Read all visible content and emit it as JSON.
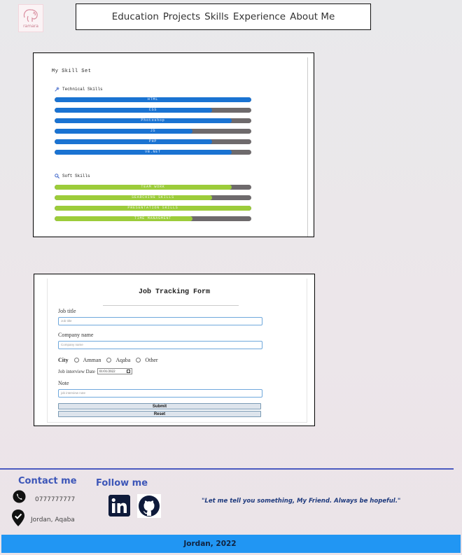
{
  "logo": {
    "text": "ramara"
  },
  "nav": {
    "items": [
      "Education",
      "Projects",
      "Skills",
      "Experience",
      "About Me"
    ]
  },
  "skills": {
    "title": "My Skill Set",
    "technical": {
      "heading": "Technical Skills",
      "icon": "tools-icon",
      "items": [
        {
          "label": "HTML",
          "percent": 100
        },
        {
          "label": "CSS",
          "percent": 80
        },
        {
          "label": "Photoshop",
          "percent": 90
        },
        {
          "label": "JS",
          "percent": 70
        },
        {
          "label": "PHP",
          "percent": 80
        },
        {
          "label": "VB.NET",
          "percent": 90
        }
      ]
    },
    "soft": {
      "heading": "Soft Skills",
      "icon": "search-icon",
      "items": [
        {
          "label": "TEAM WORK",
          "percent": 90
        },
        {
          "label": "SEARCHING SKILLS",
          "percent": 80
        },
        {
          "label": "PRESENTATION SKILLS",
          "percent": 100
        },
        {
          "label": "TIME MANAGMENT",
          "percent": 70
        }
      ]
    }
  },
  "form": {
    "title": "Job Tracking Form",
    "job_title_label": "Job title",
    "job_title_placeholder": "Job title",
    "company_label": "Company name",
    "company_placeholder": "Company name",
    "city_label": "City",
    "city_options": [
      "Amman",
      "Aqaba",
      "Other"
    ],
    "date_label": "Job interview Date",
    "date_value": "01/01/2022",
    "note_label": "Note",
    "note_placeholder": "job interview note",
    "submit_label": "Submit",
    "reset_label": "Reset"
  },
  "footer": {
    "contact_heading": "Contact me",
    "phone": "0777777777",
    "location": "Jordan, Aqaba",
    "follow_heading": "Follow  me",
    "quote": "\"Let me tell you something, My Friend. Always be hopeful.\"",
    "bottom_text": "Jordan, 2022",
    "accent_color": "#3d56b8",
    "bar_color": "#2196f3"
  }
}
